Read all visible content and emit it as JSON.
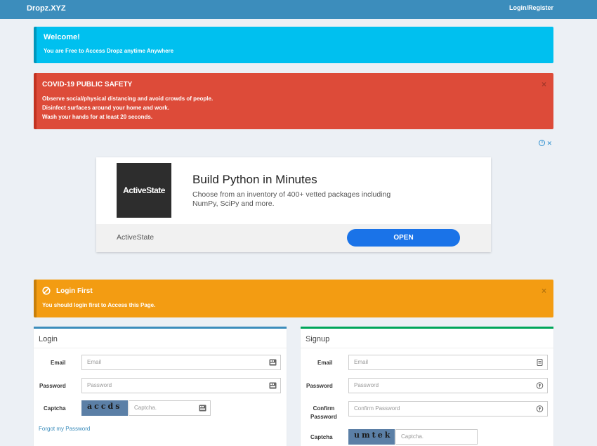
{
  "navbar": {
    "brand": "Dropz.XYZ",
    "login_register": "Login/Register"
  },
  "welcome": {
    "title": "Welcome!",
    "text": "You are Free to Access Dropz anytime Anywhere"
  },
  "covid": {
    "title": "COVID-19 PUBLIC SAFETY",
    "lines": [
      "Observe social/physical distancing and avoid crowds of people.",
      "Disinfect surfaces around your home and work.",
      "Wash your hands for at least 20 seconds."
    ],
    "close": "×"
  },
  "ad": {
    "logo_text": "ActiveState",
    "title": "Build Python in Minutes",
    "description": "Choose from an inventory of 400+ vetted packages including NumPy, SciPy and more.",
    "sponsor": "ActiveState",
    "cta": "OPEN",
    "choices_i": "i",
    "choices_x": "✕"
  },
  "login_alert": {
    "title": "Login First",
    "text": "You should login first to Access this Page.",
    "close": "×"
  },
  "login_panel": {
    "title": "Login",
    "email_label": "Email",
    "email_placeholder": "Email",
    "password_label": "Password",
    "password_placeholder": "Password",
    "captcha_label": "Captcha",
    "captcha_image_text": "accds",
    "captcha_placeholder": "Captcha.",
    "forgot": "Forgot my Password"
  },
  "signup_panel": {
    "title": "Signup",
    "email_label": "Email",
    "email_placeholder": "Email",
    "password_label": "Password",
    "password_placeholder": "Password",
    "confirm_label_1": "Confirm",
    "confirm_label_2": "Password",
    "confirm_placeholder": "Confirm Password",
    "captcha_label": "Captcha",
    "captcha_image_text": "umtek",
    "captcha_placeholder": "Captcha."
  }
}
